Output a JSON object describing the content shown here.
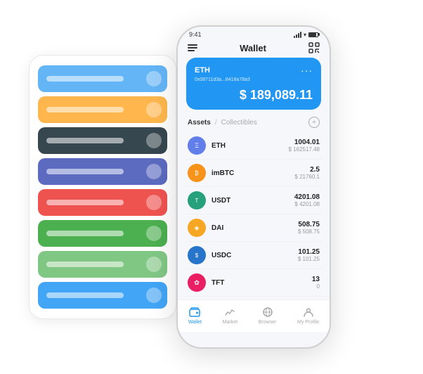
{
  "status_bar": {
    "time": "9:41"
  },
  "header": {
    "title": "Wallet"
  },
  "eth_card": {
    "symbol": "ETH",
    "address": "0x08711d3a...8418a78a3",
    "balance": "$ 189,089.11",
    "dollar_sign": "$",
    "menu_dots": "···"
  },
  "assets_section": {
    "tab_assets": "Assets",
    "divider": "/",
    "tab_collectibles": "Collectibles",
    "add_icon": "+"
  },
  "assets": [
    {
      "name": "ETH",
      "icon": "Ξ",
      "icon_class": "eth-token",
      "qty": "1004.01",
      "usd": "$ 162517.48"
    },
    {
      "name": "imBTC",
      "icon": "₿",
      "icon_class": "imbtc-token",
      "qty": "2.5",
      "usd": "$ 21760.1"
    },
    {
      "name": "USDT",
      "icon": "T",
      "icon_class": "usdt-token",
      "qty": "4201.08",
      "usd": "$ 4201.08"
    },
    {
      "name": "DAI",
      "icon": "◈",
      "icon_class": "dai-token",
      "qty": "508.75",
      "usd": "$ 508.75"
    },
    {
      "name": "USDC",
      "icon": "$",
      "icon_class": "usdc-token",
      "qty": "101.25",
      "usd": "$ 101.25"
    },
    {
      "name": "TFT",
      "icon": "✿",
      "icon_class": "tft-token",
      "qty": "13",
      "usd": "0"
    }
  ],
  "bottom_nav": [
    {
      "label": "Wallet",
      "active": true
    },
    {
      "label": "Market",
      "active": false
    },
    {
      "label": "Browser",
      "active": false
    },
    {
      "label": "My Profile",
      "active": false
    }
  ],
  "card_stack": [
    {
      "color": "#64b5f6"
    },
    {
      "color": "#ffb74d"
    },
    {
      "color": "#37474f"
    },
    {
      "color": "#5c6bc0"
    },
    {
      "color": "#ef5350"
    },
    {
      "color": "#4caf50"
    },
    {
      "color": "#81c784"
    },
    {
      "color": "#42a5f5"
    }
  ]
}
